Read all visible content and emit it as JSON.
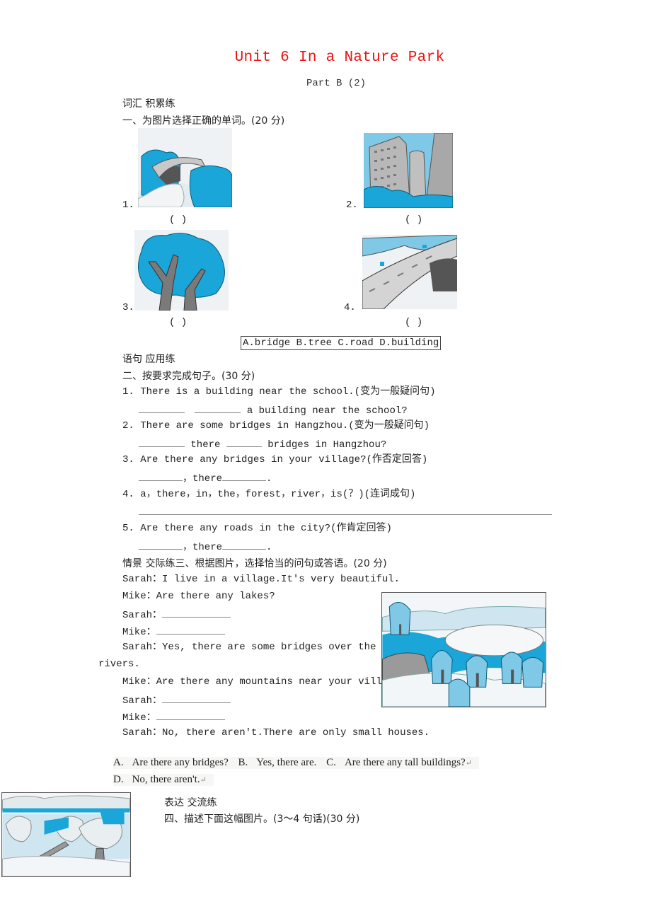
{
  "header": {
    "title": "Unit 6   In a Nature Park",
    "subtitle": "Part B (2)",
    "title_color": "#ee1111"
  },
  "section1": {
    "category": "词汇 积累练",
    "instruction": "一、为图片选择正确的单词。(20 分)",
    "items": [
      {
        "number": "1.",
        "image": "bridge-over-river-picture",
        "answer_slot": "(      )"
      },
      {
        "number": "2.",
        "image": "tall-buildings-picture",
        "answer_slot": "(      )"
      },
      {
        "number": "3.",
        "image": "tree-picture",
        "answer_slot": "(      )"
      },
      {
        "number": "4.",
        "image": "road-overpass-picture",
        "answer_slot": "(      )"
      }
    ],
    "options": "A.bridge B.tree C.road D.building"
  },
  "section2": {
    "category": "语句 应用练",
    "instruction": "二、按要求完成句子。(30 分)",
    "questions": [
      {
        "number": "1.",
        "prompt": "There is a building near the school.(变为一般疑问句)",
        "answer_tail": "a building near the school?"
      },
      {
        "number": "2.",
        "prompt": "There are some bridges in Hangzhou.(变为一般疑问句)",
        "answer_mid": "there",
        "answer_tail": "bridges in Hangzhou?"
      },
      {
        "number": "3.",
        "prompt": "Are there any bridges in your village?(作否定回答)",
        "answer_mid": "，there",
        "answer_tail": "."
      },
      {
        "number": "4.",
        "prompt": "a，there，in，the，forest，river，is(？)(连词成句)"
      },
      {
        "number": "5.",
        "prompt": "Are there any roads in the city?(作肯定回答)",
        "answer_mid": "，there",
        "answer_tail": "."
      }
    ]
  },
  "section3": {
    "heading": "情景 交际练三、根据图片，选择恰当的问句或答语。(20 分)",
    "dialogue": [
      {
        "speaker": "Sarah：",
        "text": "I live in a village.It's very beautiful."
      },
      {
        "speaker": "Mike：",
        "text": "Are there any lakes?"
      },
      {
        "speaker": "Sarah：",
        "text": ""
      },
      {
        "speaker": "Mike：",
        "text": ""
      },
      {
        "speaker": "Sarah：",
        "text": "Yes, there are some bridges over the"
      },
      {
        "speaker": "",
        "text": "rivers."
      },
      {
        "speaker": "Mike：",
        "text": "Are there any mountains near your villag"
      },
      {
        "speaker": "Sarah：",
        "text": ""
      },
      {
        "speaker": "Mike：",
        "text": ""
      },
      {
        "speaker": "Sarah：",
        "text": "No, there aren't.There are only small houses."
      }
    ],
    "image": "village-lake-picture",
    "options": [
      {
        "key": "A.",
        "text": "Are there any bridges?"
      },
      {
        "key": "B.",
        "text": "Yes, there are."
      },
      {
        "key": "C.",
        "text": "Are there any tall buildings?"
      },
      {
        "key": "D.",
        "text": "No, there aren't."
      }
    ],
    "return_mark": "↵"
  },
  "section4": {
    "category": "表达 交流练",
    "instruction": "四、描述下面这幅图片。(3～4 句话)(30 分)",
    "image": "park-bridge-trees-picture"
  }
}
